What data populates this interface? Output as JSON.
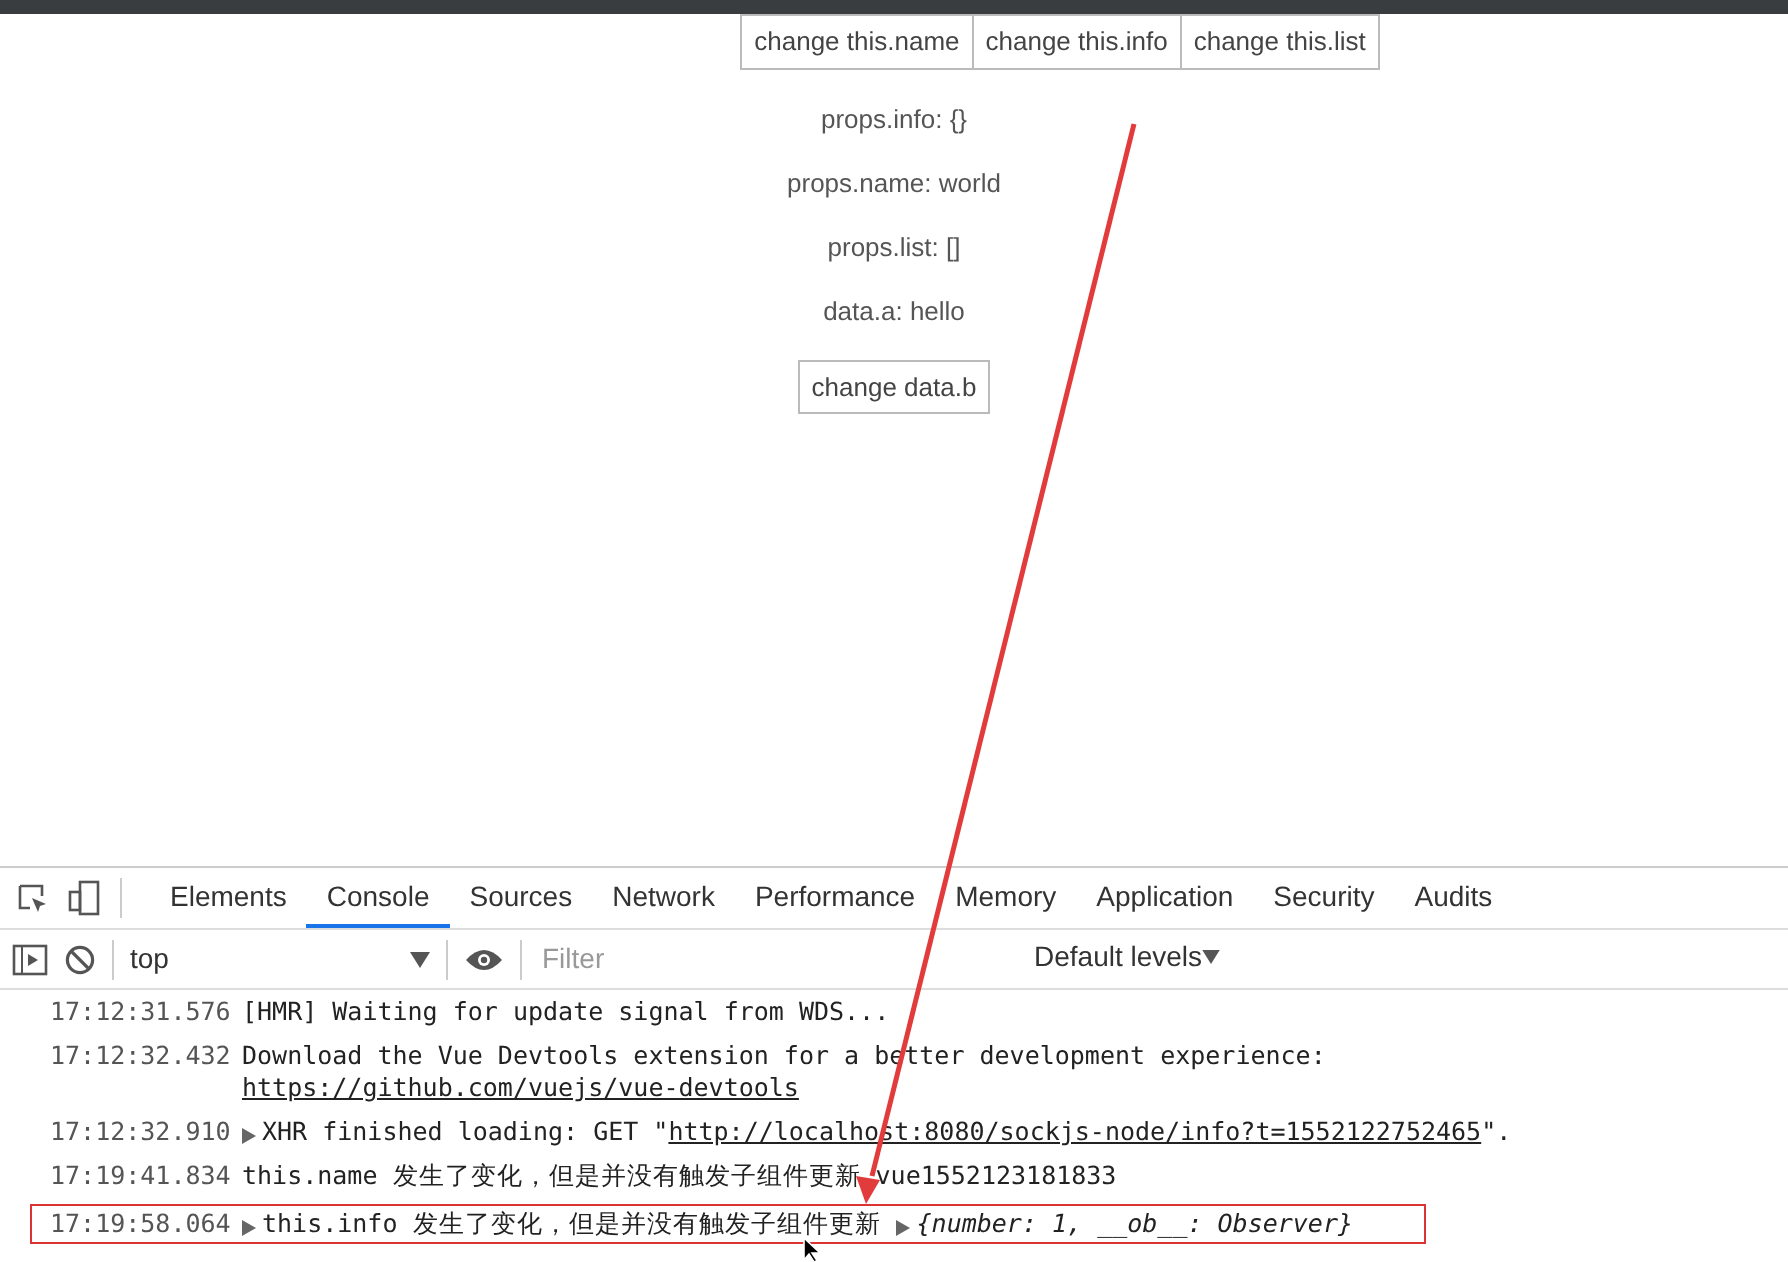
{
  "page": {
    "buttons": [
      "change this.name",
      "change this.info",
      "change this.list"
    ],
    "lines": [
      "props.info: {}",
      "props.name: world",
      "props.list: []",
      "data.a: hello"
    ],
    "data_button": "change data.b"
  },
  "devtools": {
    "tabs": [
      {
        "label": "Elements",
        "selected": false
      },
      {
        "label": "Console",
        "selected": true
      },
      {
        "label": "Sources",
        "selected": false
      },
      {
        "label": "Network",
        "selected": false
      },
      {
        "label": "Performance",
        "selected": false
      },
      {
        "label": "Memory",
        "selected": false
      },
      {
        "label": "Application",
        "selected": false
      },
      {
        "label": "Security",
        "selected": false
      },
      {
        "label": "Audits",
        "selected": false
      }
    ],
    "context": "top",
    "filter_placeholder": "Filter",
    "levels": "Default levels",
    "log": [
      {
        "time": "17:12:31.576",
        "text": "[HMR] Waiting for update signal from WDS...",
        "expandable": false,
        "highlighted": false
      },
      {
        "time": "17:12:32.432",
        "text": "Download the Vue Devtools extension for a better development experience:",
        "link": "https://github.com/vuejs/vue-devtools",
        "link_on_new_line": true,
        "expandable": false,
        "highlighted": false
      },
      {
        "time": "17:12:32.910",
        "text": "XHR finished loading: GET \"",
        "link": "http://localhost:8080/sockjs-node/info?t=1552122752465",
        "suffix": "\".",
        "expandable": true,
        "highlighted": false
      },
      {
        "time": "17:19:41.834",
        "text": "this.name 发生了变化，但是并没有触发子组件更新 vue1552123181833",
        "expandable": false,
        "highlighted": false
      },
      {
        "time": "17:19:58.064",
        "text": "this.info 发生了变化，但是并没有触发子组件更新",
        "object": "{number: 1, __ob__: Observer}",
        "expandable": true,
        "highlighted": true
      }
    ]
  }
}
